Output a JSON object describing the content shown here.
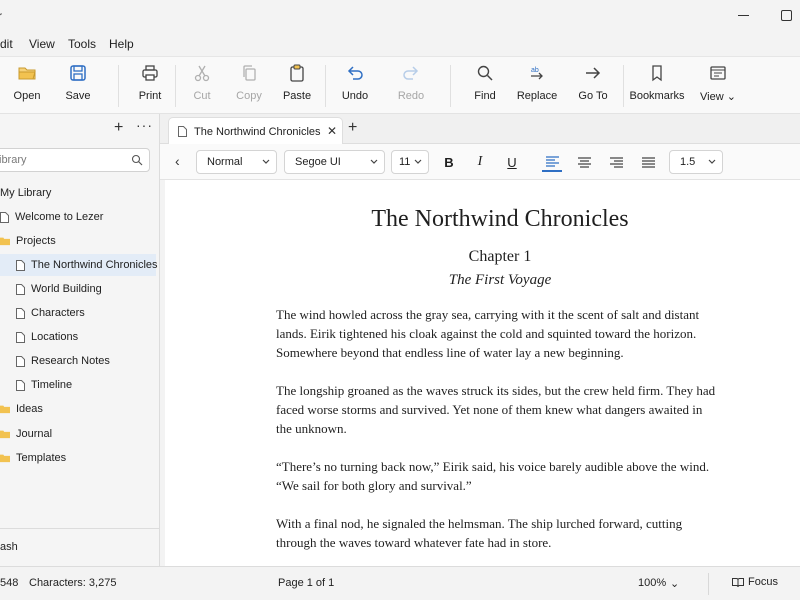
{
  "window": {
    "title": "r"
  },
  "menu": [
    "dit",
    "View",
    "Tools",
    "Help"
  ],
  "toolbar": {
    "open": "Open",
    "save": "Save",
    "print": "Print",
    "cut": "Cut",
    "copy": "Copy",
    "paste": "Paste",
    "undo": "Undo",
    "redo": "Redo",
    "find": "Find",
    "replace": "Replace",
    "goto": "Go To",
    "bookmarks": "Bookmarks",
    "view": "View"
  },
  "sidebar": {
    "search_placeholder": "ibrary",
    "root": "My Library",
    "items": [
      {
        "label": "Welcome to Lezer"
      },
      {
        "label": "Projects"
      },
      {
        "label": "The Northwind Chronicles"
      },
      {
        "label": "World Building"
      },
      {
        "label": "Characters"
      },
      {
        "label": "Locations"
      },
      {
        "label": "Research Notes"
      },
      {
        "label": "Timeline"
      },
      {
        "label": "Ideas"
      },
      {
        "label": "Journal"
      },
      {
        "label": "Templates"
      }
    ],
    "footer": "ash"
  },
  "tab": {
    "label": "The Northwind Chronicles"
  },
  "format": {
    "style": "Normal",
    "font": "Segoe UI",
    "size": "11",
    "line_spacing": "1.5"
  },
  "document": {
    "title": "The Northwind Chronicles",
    "chapter": "Chapter 1",
    "subtitle": "The First Voyage",
    "paragraphs": [
      "The wind howled across the gray sea, carrying with it the scent of salt and distant lands. Eirik tightened his cloak against the cold and squinted toward the horizon. Somewhere beyond that endless line of water lay a new beginning.",
      "The longship groaned as the waves struck its sides, but the crew held firm. They had faced worse storms and survived. Yet none of them knew what dangers awaited in the unknown.",
      "“There’s no turning back now,” Eirik said, his voice barely audible above the wind. “We sail for both glory and survival.”",
      "With a final nod, he signaled the helmsman. The ship lurched forward, cutting through the waves toward whatever fate had in store."
    ]
  },
  "status": {
    "words": "548",
    "characters": "Characters: 3,275",
    "page": "Page 1 of 1",
    "zoom": "100%",
    "focus": "Focus"
  },
  "colors": {
    "accent": "#2f6fc4",
    "selected": "#e3ecf7",
    "folder": "#f2c250"
  }
}
